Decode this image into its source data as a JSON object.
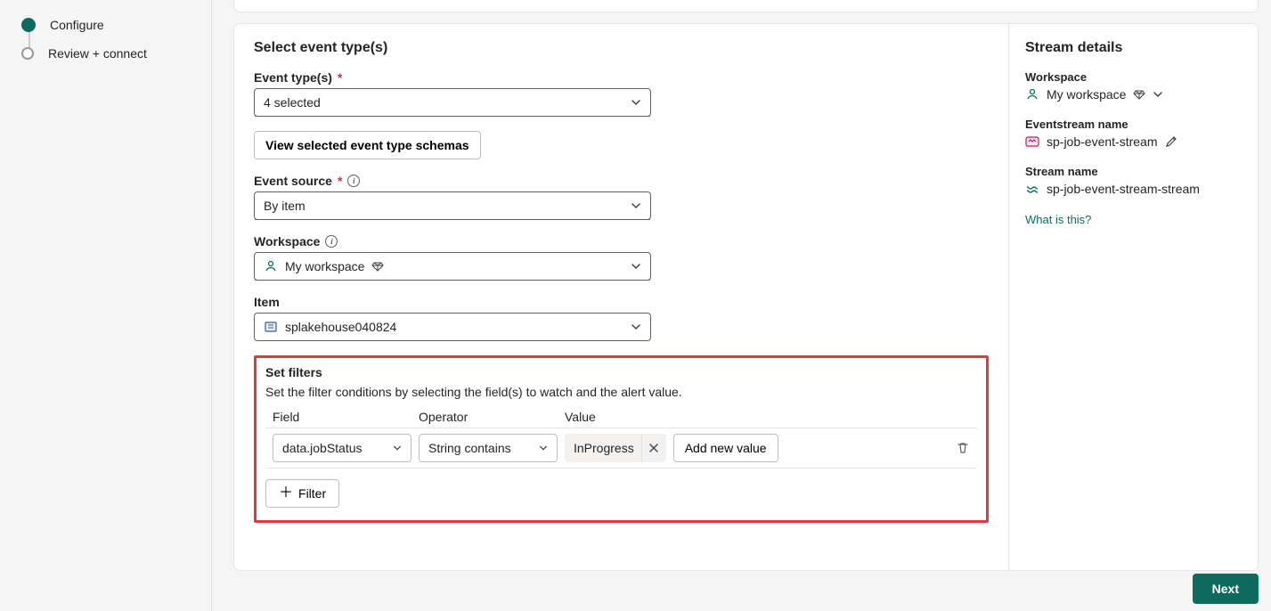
{
  "stepper": {
    "configure": "Configure",
    "review": "Review + connect"
  },
  "form": {
    "title": "Select event type(s)",
    "event_types_label": "Event type(s)",
    "event_types_value": "4 selected",
    "view_schemas": "View selected event type schemas",
    "event_source_label": "Event source",
    "event_source_value": "By item",
    "workspace_label": "Workspace",
    "workspace_value": "My workspace",
    "item_label": "Item",
    "item_value": "splakehouse040824"
  },
  "filters": {
    "title": "Set filters",
    "description": "Set the filter conditions by selecting the field(s) to watch and the alert value.",
    "col_field": "Field",
    "col_operator": "Operator",
    "col_value": "Value",
    "row": {
      "field": "data.jobStatus",
      "operator": "String contains",
      "value": "InProgress",
      "add_value": "Add new value"
    },
    "add_filter": "Filter"
  },
  "details": {
    "title": "Stream details",
    "workspace_label": "Workspace",
    "workspace_value": "My workspace",
    "eventstream_label": "Eventstream name",
    "eventstream_value": "sp-job-event-stream",
    "stream_label": "Stream name",
    "stream_value": "sp-job-event-stream-stream",
    "help_link": "What is this?"
  },
  "footer": {
    "next": "Next"
  }
}
